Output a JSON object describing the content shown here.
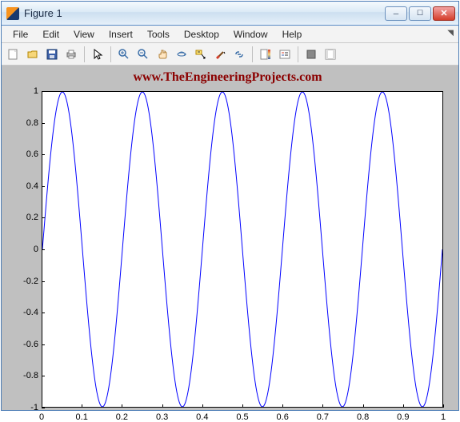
{
  "window": {
    "title": "Figure 1"
  },
  "menu": {
    "file": "File",
    "edit": "Edit",
    "view": "View",
    "insert": "Insert",
    "tools": "Tools",
    "desktop": "Desktop",
    "window": "Window",
    "help": "Help"
  },
  "toolbar_icons": {
    "new": "new-figure-icon",
    "open": "open-icon",
    "save": "save-icon",
    "print": "print-icon",
    "pointer": "pointer-icon",
    "zoom_in": "zoom-in-icon",
    "zoom_out": "zoom-out-icon",
    "pan": "pan-icon",
    "rotate3d": "rotate-3d-icon",
    "datacursor": "data-cursor-icon",
    "brush": "brush-icon",
    "link": "link-icon",
    "colorbar": "colorbar-icon",
    "legend": "legend-icon",
    "hideplot": "hide-plot-tools-icon",
    "showplot": "show-plot-tools-icon"
  },
  "title_text": "www.TheEngineeringProjects.com",
  "chart_data": {
    "type": "line",
    "title": "www.TheEngineeringProjects.com",
    "xlabel": "",
    "ylabel": "",
    "xlim": [
      0,
      1
    ],
    "ylim": [
      -1,
      1
    ],
    "xticks": [
      0,
      0.1,
      0.2,
      0.3,
      0.4,
      0.5,
      0.6,
      0.7,
      0.8,
      0.9,
      1
    ],
    "yticks": [
      -1,
      -0.8,
      -0.6,
      -0.4,
      -0.2,
      0,
      0.2,
      0.4,
      0.6,
      0.8,
      1
    ],
    "series": [
      {
        "name": "sine",
        "color": "#0000ff",
        "function": "sin(2*pi*5*x)",
        "frequency_hz": 5,
        "amplitude": 1,
        "x_range": [
          0,
          1
        ],
        "num_points": 501
      }
    ]
  },
  "colors": {
    "figure_bg": "#c0c0c0",
    "axes_bg": "#ffffff",
    "line": "#0000ff",
    "title": "#8b0000"
  }
}
